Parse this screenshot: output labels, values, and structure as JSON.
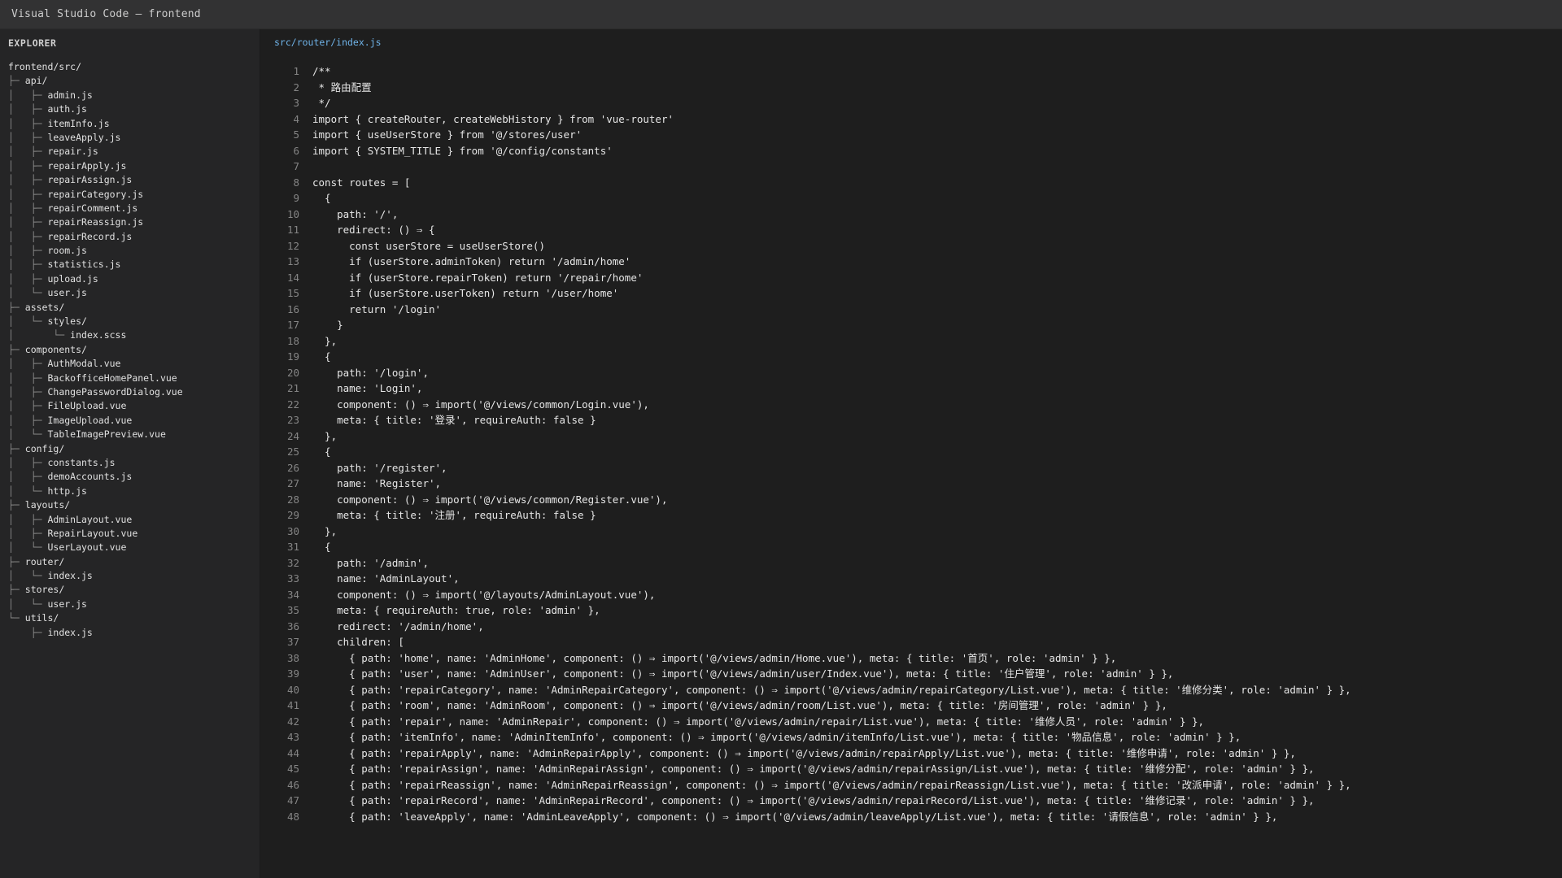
{
  "window": {
    "title": "Visual Studio Code — frontend"
  },
  "sidebar": {
    "header": "EXPLORER",
    "tree": [
      {
        "prefix": "",
        "name": "frontend/src/"
      },
      {
        "prefix": "├─ ",
        "name": "api/"
      },
      {
        "prefix": "│   ├─ ",
        "name": "admin.js"
      },
      {
        "prefix": "│   ├─ ",
        "name": "auth.js"
      },
      {
        "prefix": "│   ├─ ",
        "name": "itemInfo.js"
      },
      {
        "prefix": "│   ├─ ",
        "name": "leaveApply.js"
      },
      {
        "prefix": "│   ├─ ",
        "name": "repair.js"
      },
      {
        "prefix": "│   ├─ ",
        "name": "repairApply.js"
      },
      {
        "prefix": "│   ├─ ",
        "name": "repairAssign.js"
      },
      {
        "prefix": "│   ├─ ",
        "name": "repairCategory.js"
      },
      {
        "prefix": "│   ├─ ",
        "name": "repairComment.js"
      },
      {
        "prefix": "│   ├─ ",
        "name": "repairReassign.js"
      },
      {
        "prefix": "│   ├─ ",
        "name": "repairRecord.js"
      },
      {
        "prefix": "│   ├─ ",
        "name": "room.js"
      },
      {
        "prefix": "│   ├─ ",
        "name": "statistics.js"
      },
      {
        "prefix": "│   ├─ ",
        "name": "upload.js"
      },
      {
        "prefix": "│   └─ ",
        "name": "user.js"
      },
      {
        "prefix": "├─ ",
        "name": "assets/"
      },
      {
        "prefix": "│   └─ ",
        "name": "styles/"
      },
      {
        "prefix": "│       └─ ",
        "name": "index.scss"
      },
      {
        "prefix": "├─ ",
        "name": "components/"
      },
      {
        "prefix": "│   ├─ ",
        "name": "AuthModal.vue"
      },
      {
        "prefix": "│   ├─ ",
        "name": "BackofficeHomePanel.vue"
      },
      {
        "prefix": "│   ├─ ",
        "name": "ChangePasswordDialog.vue"
      },
      {
        "prefix": "│   ├─ ",
        "name": "FileUpload.vue"
      },
      {
        "prefix": "│   ├─ ",
        "name": "ImageUpload.vue"
      },
      {
        "prefix": "│   └─ ",
        "name": "TableImagePreview.vue"
      },
      {
        "prefix": "├─ ",
        "name": "config/"
      },
      {
        "prefix": "│   ├─ ",
        "name": "constants.js"
      },
      {
        "prefix": "│   ├─ ",
        "name": "demoAccounts.js"
      },
      {
        "prefix": "│   └─ ",
        "name": "http.js"
      },
      {
        "prefix": "├─ ",
        "name": "layouts/"
      },
      {
        "prefix": "│   ├─ ",
        "name": "AdminLayout.vue"
      },
      {
        "prefix": "│   ├─ ",
        "name": "RepairLayout.vue"
      },
      {
        "prefix": "│   └─ ",
        "name": "UserLayout.vue"
      },
      {
        "prefix": "├─ ",
        "name": "router/"
      },
      {
        "prefix": "│   └─ ",
        "name": "index.js"
      },
      {
        "prefix": "├─ ",
        "name": "stores/"
      },
      {
        "prefix": "│   └─ ",
        "name": "user.js"
      },
      {
        "prefix": "└─ ",
        "name": "utils/"
      },
      {
        "prefix": "    ├─ ",
        "name": "index.js"
      }
    ]
  },
  "editor": {
    "tab": "src/router/index.js",
    "lines": [
      "/**",
      " * 路由配置",
      " */",
      "import { createRouter, createWebHistory } from 'vue-router'",
      "import { useUserStore } from '@/stores/user'",
      "import { SYSTEM_TITLE } from '@/config/constants'",
      "",
      "const routes = [",
      "  {",
      "    path: '/',",
      "    redirect: () ⇒ {",
      "      const userStore = useUserStore()",
      "      if (userStore.adminToken) return '/admin/home'",
      "      if (userStore.repairToken) return '/repair/home'",
      "      if (userStore.userToken) return '/user/home'",
      "      return '/login'",
      "    }",
      "  },",
      "  {",
      "    path: '/login',",
      "    name: 'Login',",
      "    component: () ⇒ import('@/views/common/Login.vue'),",
      "    meta: { title: '登录', requireAuth: false }",
      "  },",
      "  {",
      "    path: '/register',",
      "    name: 'Register',",
      "    component: () ⇒ import('@/views/common/Register.vue'),",
      "    meta: { title: '注册', requireAuth: false }",
      "  },",
      "  {",
      "    path: '/admin',",
      "    name: 'AdminLayout',",
      "    component: () ⇒ import('@/layouts/AdminLayout.vue'),",
      "    meta: { requireAuth: true, role: 'admin' },",
      "    redirect: '/admin/home',",
      "    children: [",
      "      { path: 'home', name: 'AdminHome', component: () ⇒ import('@/views/admin/Home.vue'), meta: { title: '首页', role: 'admin' } },",
      "      { path: 'user', name: 'AdminUser', component: () ⇒ import('@/views/admin/user/Index.vue'), meta: { title: '住户管理', role: 'admin' } },",
      "      { path: 'repairCategory', name: 'AdminRepairCategory', component: () ⇒ import('@/views/admin/repairCategory/List.vue'), meta: { title: '维修分类', role: 'admin' } },",
      "      { path: 'room', name: 'AdminRoom', component: () ⇒ import('@/views/admin/room/List.vue'), meta: { title: '房间管理', role: 'admin' } },",
      "      { path: 'repair', name: 'AdminRepair', component: () ⇒ import('@/views/admin/repair/List.vue'), meta: { title: '维修人员', role: 'admin' } },",
      "      { path: 'itemInfo', name: 'AdminItemInfo', component: () ⇒ import('@/views/admin/itemInfo/List.vue'), meta: { title: '物品信息', role: 'admin' } },",
      "      { path: 'repairApply', name: 'AdminRepairApply', component: () ⇒ import('@/views/admin/repairApply/List.vue'), meta: { title: '维修申请', role: 'admin' } },",
      "      { path: 'repairAssign', name: 'AdminRepairAssign', component: () ⇒ import('@/views/admin/repairAssign/List.vue'), meta: { title: '维修分配', role: 'admin' } },",
      "      { path: 'repairReassign', name: 'AdminRepairReassign', component: () ⇒ import('@/views/admin/repairReassign/List.vue'), meta: { title: '改派申请', role: 'admin' } },",
      "      { path: 'repairRecord', name: 'AdminRepairRecord', component: () ⇒ import('@/views/admin/repairRecord/List.vue'), meta: { title: '维修记录', role: 'admin' } },",
      "      { path: 'leaveApply', name: 'AdminLeaveApply', component: () ⇒ import('@/views/admin/leaveApply/List.vue'), meta: { title: '请假信息', role: 'admin' } },"
    ]
  }
}
